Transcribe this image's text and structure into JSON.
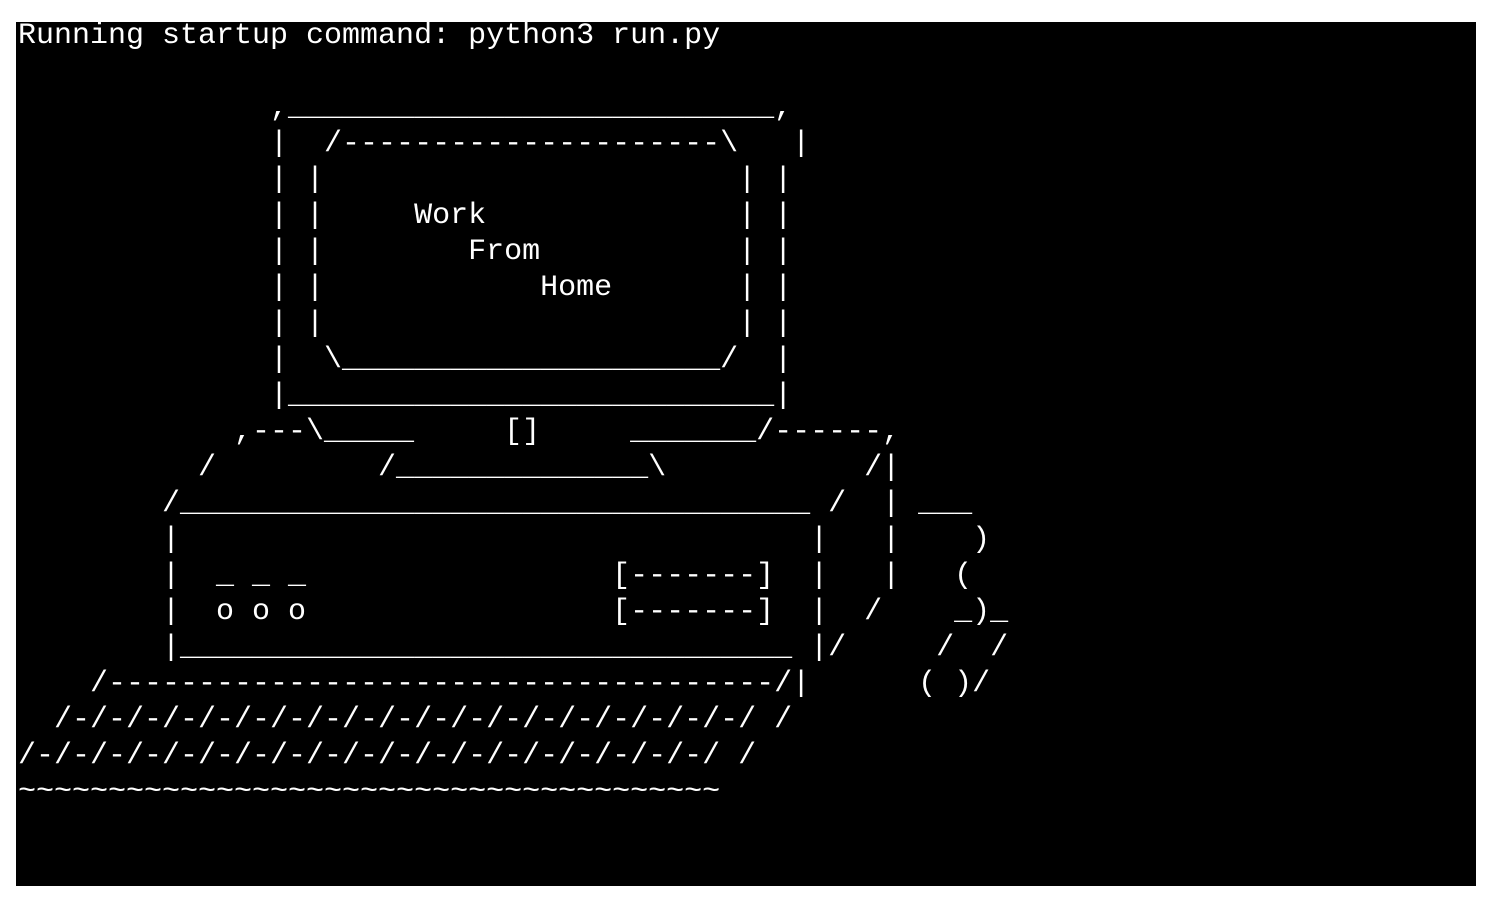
{
  "terminal": {
    "startup_line": "Running startup command: python3 run.py",
    "ascii_art": [
      "",
      "              ,___________________________,",
      "              |  /---------------------\\   |",
      "              | |                       | |",
      "              | |     Work              | |",
      "              | |        From           | |",
      "              | |            Home       | |",
      "              | |                       | |",
      "              |  \\_____________________/  |",
      "              |___________________________|",
      "            ,---\\_____     []     _______/------,",
      "          /         /______________\\           /|",
      "        /___________________________________ /  | ___",
      "        |                                   |   |    )",
      "        |  _ _ _                 [-------]  |   |   (",
      "        |  o o o                 [-------]  |  /    _)_",
      "        |__________________________________ |/     /  /",
      "    /-------------------------------------/|      ( )/",
      "  /-/-/-/-/-/-/-/-/-/-/-/-/-/-/-/-/-/-/-/ /",
      "/-/-/-/-/-/-/-/-/-/-/-/-/-/-/-/-/-/-/-/ /",
      "~~~~~~~~~~~~~~~~~~~~~~~~~~~~~~~~~~~~~~~"
    ]
  }
}
